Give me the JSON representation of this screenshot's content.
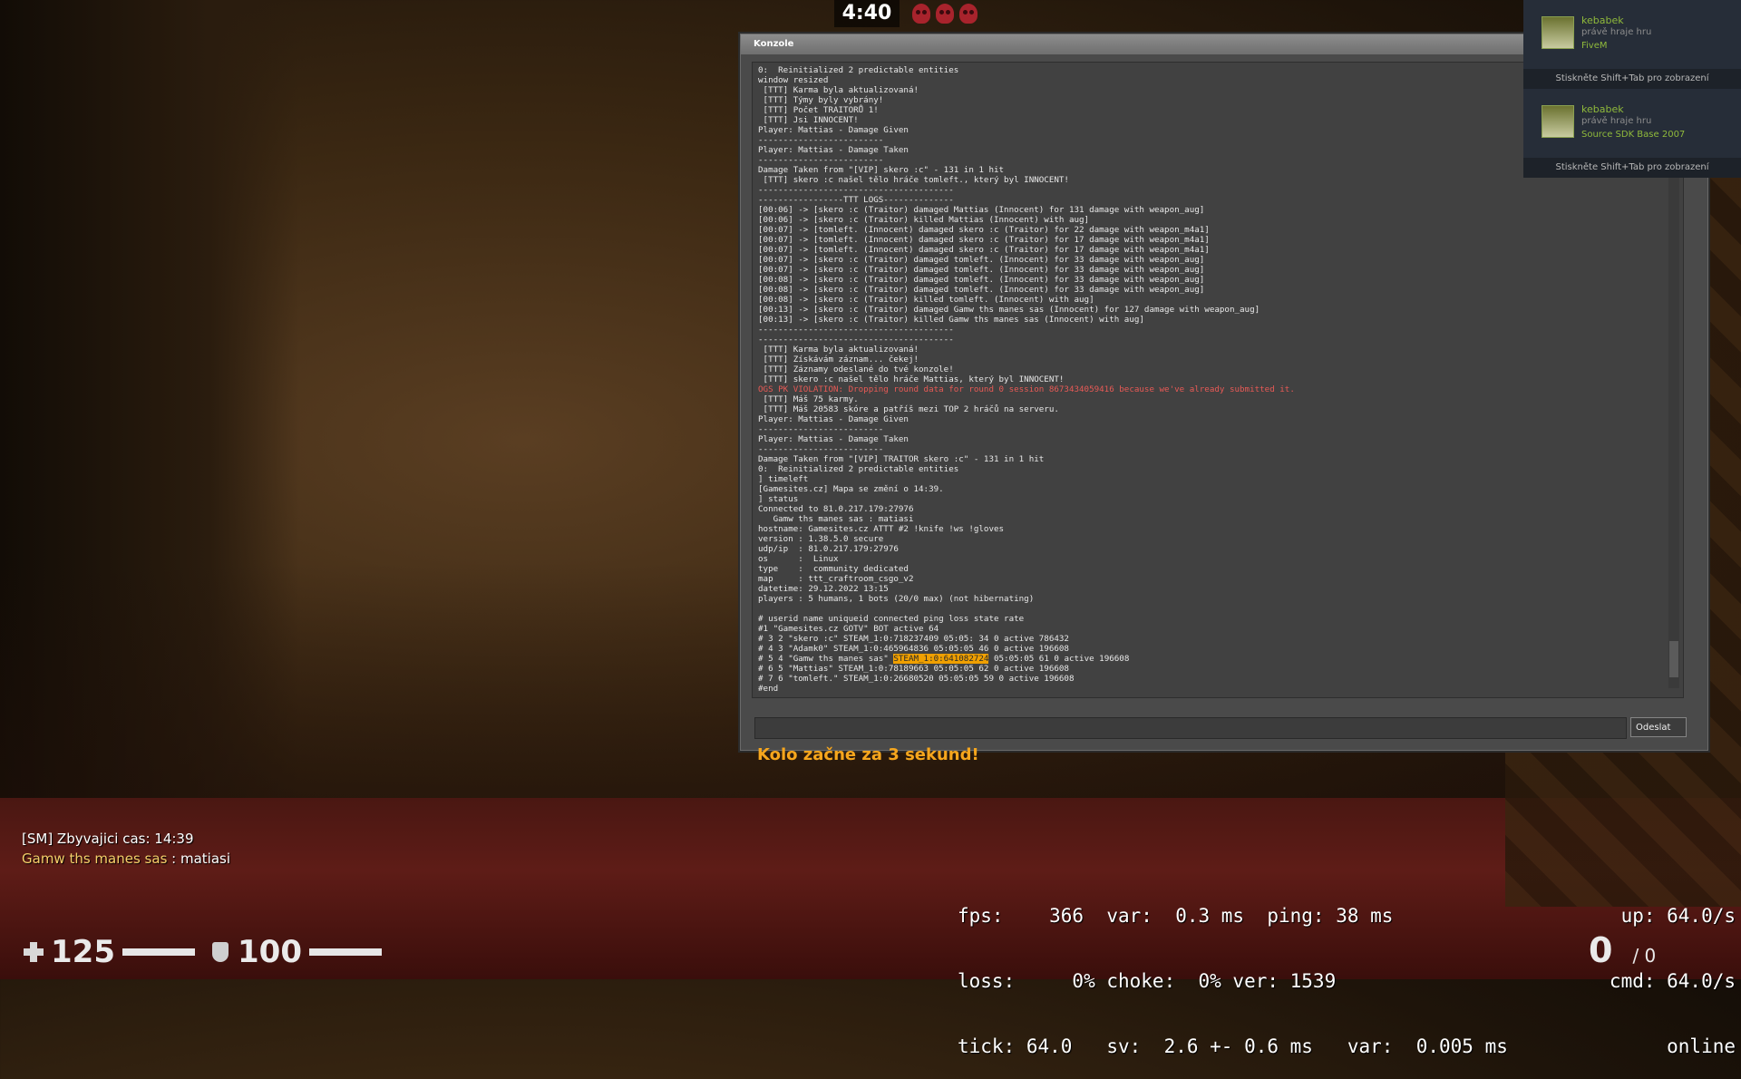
{
  "hud_top": {
    "round_timer": "4:40"
  },
  "console": {
    "title": "Konzole",
    "submit_label": "Odeslat",
    "input_value": "",
    "lines": [
      {
        "t": "0:  Reinitialized 2 predictable entities"
      },
      {
        "t": "window resized"
      },
      {
        "t": " [TTT] Karma byla aktualizovaná!"
      },
      {
        "t": " [TTT] Týmy byly vybrány!"
      },
      {
        "t": " [TTT] Počet TRAITORŮ 1!"
      },
      {
        "t": " [TTT] Jsi INNOCENT!"
      },
      {
        "t": "Player: Mattias - Damage Given"
      },
      {
        "t": "-------------------------"
      },
      {
        "t": "Player: Mattias - Damage Taken"
      },
      {
        "t": "-------------------------"
      },
      {
        "t": "Damage Taken from \"[VIP] skero :c\" - 131 in 1 hit"
      },
      {
        "t": " [TTT] skero :c našel tělo hráče tomleft., který byl INNOCENT!"
      },
      {
        "t": "---------------------------------------"
      },
      {
        "t": "-----------------TTT LOGS--------------"
      },
      {
        "t": "[00:06] -> [skero :c (Traitor) damaged Mattias (Innocent) for 131 damage with weapon_aug]"
      },
      {
        "t": "[00:06] -> [skero :c (Traitor) killed Mattias (Innocent) with aug]"
      },
      {
        "t": "[00:07] -> [tomleft. (Innocent) damaged skero :c (Traitor) for 22 damage with weapon_m4a1]"
      },
      {
        "t": "[00:07] -> [tomleft. (Innocent) damaged skero :c (Traitor) for 17 damage with weapon_m4a1]"
      },
      {
        "t": "[00:07] -> [tomleft. (Innocent) damaged skero :c (Traitor) for 17 damage with weapon_m4a1]"
      },
      {
        "t": "[00:07] -> [skero :c (Traitor) damaged tomleft. (Innocent) for 33 damage with weapon_aug]"
      },
      {
        "t": "[00:07] -> [skero :c (Traitor) damaged tomleft. (Innocent) for 33 damage with weapon_aug]"
      },
      {
        "t": "[00:08] -> [skero :c (Traitor) damaged tomleft. (Innocent) for 33 damage with weapon_aug]"
      },
      {
        "t": "[00:08] -> [skero :c (Traitor) damaged tomleft. (Innocent) for 33 damage with weapon_aug]"
      },
      {
        "t": "[00:08] -> [skero :c (Traitor) killed tomleft. (Innocent) with aug]"
      },
      {
        "t": "[00:13] -> [skero :c (Traitor) damaged Gamw ths manes sas (Innocent) for 127 damage with weapon_aug]"
      },
      {
        "t": "[00:13] -> [skero :c (Traitor) killed Gamw ths manes sas (Innocent) with aug]"
      },
      {
        "t": "---------------------------------------"
      },
      {
        "t": "---------------------------------------"
      },
      {
        "t": " [TTT] Karma byla aktualizovaná!"
      },
      {
        "t": " [TTT] Získávám záznam... čekej!"
      },
      {
        "t": " [TTT] Záznamy odeslané do tvé konzole!"
      },
      {
        "t": " [TTT] skero :c našel tělo hráče Mattias, který byl INNOCENT!"
      },
      {
        "t": "OGS PK VIOLATION: Dropping round data for round 0 session 8673434059416 because we've already submitted it.",
        "err": true
      },
      {
        "t": " [TTT] Máš 75 karmy."
      },
      {
        "t": " [TTT] Máš 20583 skóre a patříš mezi TOP 2 hráčů na serveru."
      },
      {
        "t": "Player: Mattias - Damage Given"
      },
      {
        "t": "-------------------------"
      },
      {
        "t": "Player: Mattias - Damage Taken"
      },
      {
        "t": "-------------------------"
      },
      {
        "t": "Damage Taken from \"[VIP] TRAITOR skero :c\" - 131 in 1 hit"
      },
      {
        "t": "0:  Reinitialized 2 predictable entities"
      },
      {
        "t": "] timeleft"
      },
      {
        "t": "[Gamesites.cz] Mapa se změní o 14:39."
      },
      {
        "t": "] status"
      },
      {
        "t": "Connected to 81.0.217.179:27976"
      },
      {
        "t": "   Gamw ths manes sas : matiasi"
      },
      {
        "t": "hostname: Gamesites.cz ATTT #2 !knife !ws !gloves"
      },
      {
        "t": "version : 1.38.5.0 secure"
      },
      {
        "t": "udp/ip  : 81.0.217.179:27976"
      },
      {
        "t": "os      :  Linux"
      },
      {
        "t": "type    :  community dedicated"
      },
      {
        "t": "map     : ttt_craftroom_csgo_v2"
      },
      {
        "t": "datetime: 29.12.2022 13:15"
      },
      {
        "t": "players : 5 humans, 1 bots (20/0 max) (not hibernating)"
      },
      {
        "t": ""
      },
      {
        "t": "# userid name uniqueid connected ping loss state rate"
      },
      {
        "t": "#1 \"Gamesites.cz GOTV\" BOT active 64"
      },
      {
        "t": "# 3 2 \"skero :c\" STEAM_1:0:718237409 05:05: 34 0 active 786432"
      },
      {
        "t": "# 4 3 \"Adamk0\" STEAM_1:0:465964836 05:05:05 46 0 active 196608"
      },
      {
        "t": "# 5 4 \"Gamw ths manes sas\" ",
        "hl": "STEAM_1:0:641082724",
        "after": " 05:05:05 61 0 active 196608"
      },
      {
        "t": "# 6 5 \"Mattias\" STEAM_1:0:78189663 05:05:05 62 0 active 196608"
      },
      {
        "t": "# 7 6 \"tomleft.\" STEAM_1:0:26680520 05:05:05 59 0 active 196608"
      },
      {
        "t": "#end"
      }
    ]
  },
  "round_message": "Kolo začne za 3 sekund!",
  "notifications": [
    {
      "name": "kebabek",
      "status": "právě hraje hru",
      "game": "FiveM",
      "footer": "Stiskněte Shift+Tab pro zobrazení"
    },
    {
      "name": "kebabek",
      "status": "právě hraje hru",
      "game": "Source SDK Base 2007",
      "footer": "Stiskněte Shift+Tab pro zobrazení"
    }
  ],
  "chat": [
    {
      "prefix": "",
      "name": "",
      "text": "[SM] Zbyvajici cas: 14:39"
    },
    {
      "prefix": "",
      "name": "Gamw ths manes sas",
      "text": " : matiasi"
    }
  ],
  "netgraph": {
    "lines": [
      "fps:    366  var:  0.3 ms  ping: 38 ms",
      "loss:     0% choke:  0% ver: 1539",
      "tick: 64.0   sv:  2.6 +- 0.6 ms   var:  0.005 ms"
    ],
    "right_lines": [
      "up: 64.0/s",
      "cmd: 64.0/s",
      "online"
    ]
  },
  "hud": {
    "health": "125",
    "armor": "100",
    "ammo_clip": "0",
    "ammo_reserve": "/ 0"
  },
  "colors": {
    "round_message": "#f6a61d",
    "steam_green": "#8fb93b",
    "error_red": "#e85a56",
    "highlight": "#f0a000"
  }
}
